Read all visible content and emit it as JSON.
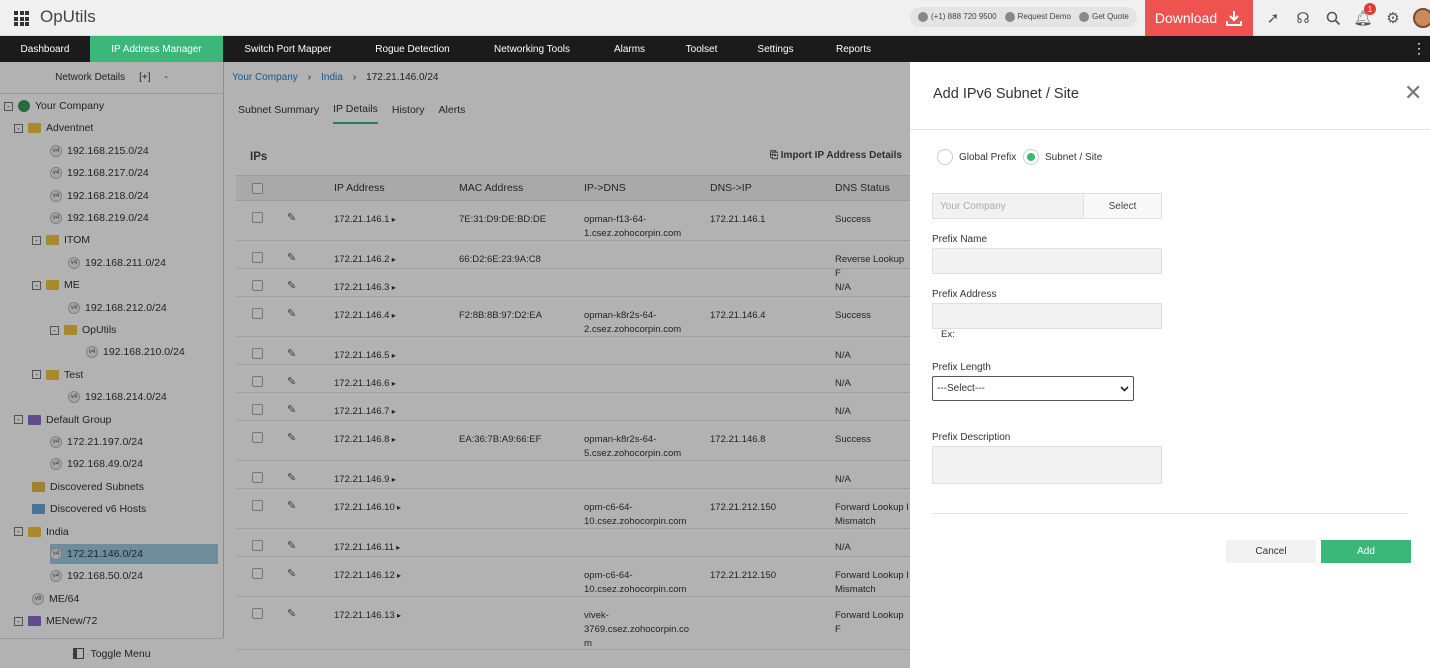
{
  "app": {
    "title": "OpUtils"
  },
  "contact": {
    "phone": "(+1) 888 720 9500",
    "demo": "Request Demo",
    "quote": "Get Quote"
  },
  "download_label": "Download",
  "notification_count": "1",
  "colors": {
    "brand_green": "#3ab779",
    "download_red": "#ef5350",
    "nav_bg": "#1b1b1b"
  },
  "nav": [
    "Dashboard",
    "IP Address Manager",
    "Switch Port Mapper",
    "Rogue Detection",
    "Networking Tools",
    "Alarms",
    "Toolset",
    "Settings",
    "Reports"
  ],
  "nav_active": "IP Address Manager",
  "sidebar": {
    "header": "Network Details",
    "expand": "[+]",
    "collapse": "-",
    "footer": "Toggle Menu",
    "tree": [
      {
        "label": "Your Company",
        "icon": "globe-icon",
        "toggle": "-"
      },
      {
        "label": "Adventnet",
        "icon": "folder-icon",
        "toggle": "-"
      },
      {
        "label": "192.168.215.0/24",
        "icon": "v4"
      },
      {
        "label": "192.168.217.0/24",
        "icon": "v4"
      },
      {
        "label": "192.168.218.0/24",
        "icon": "v4"
      },
      {
        "label": "192.168.219.0/24",
        "icon": "v4"
      },
      {
        "label": "ITOM",
        "icon": "folder-icon",
        "toggle": "-"
      },
      {
        "label": "192.168.211.0/24",
        "icon": "v4"
      },
      {
        "label": "ME",
        "icon": "folder-icon",
        "toggle": "-"
      },
      {
        "label": "192.168.212.0/24",
        "icon": "v4"
      },
      {
        "label": "OpUtils",
        "icon": "folder-icon",
        "toggle": "-"
      },
      {
        "label": "192.168.210.0/24",
        "icon": "v4"
      },
      {
        "label": "Test",
        "icon": "folder-icon",
        "toggle": "-"
      },
      {
        "label": "192.168.214.0/24",
        "icon": "v4"
      },
      {
        "label": "Default Group",
        "icon": "purple-folder-icon",
        "toggle": "-"
      },
      {
        "label": "172.21.197.0/24",
        "icon": "v4"
      },
      {
        "label": "192.168.49.0/24",
        "icon": "v4"
      },
      {
        "label": "Discovered Subnets",
        "icon": "discovered-subnets-icon"
      },
      {
        "label": "Discovered v6 Hosts",
        "icon": "discovered-hosts-icon"
      },
      {
        "label": "India",
        "icon": "folder-icon",
        "toggle": "-"
      },
      {
        "label": "172.21.146.0/24",
        "icon": "v4",
        "selected": true
      },
      {
        "label": "192.168.50.0/24",
        "icon": "v4"
      },
      {
        "label": "ME/64",
        "icon": "v6"
      },
      {
        "label": "MENew/72",
        "icon": "purple-folder-icon",
        "toggle": "-"
      }
    ]
  },
  "breadcrumb": [
    "Your Company",
    "India",
    "172.21.146.0/24"
  ],
  "tabs": [
    "Subnet Summary",
    "IP Details",
    "History",
    "Alerts"
  ],
  "active_tab": "IP Details",
  "ips_label": "IPs",
  "import_label": "Import IP Address Details",
  "table": {
    "columns": [
      "IP Address",
      "MAC Address",
      "IP->DNS",
      "DNS->IP",
      "DNS Status"
    ],
    "rows": [
      {
        "ip": "172.21.146.1",
        "mac": "7E:31:D9:DE:BD:DE",
        "ipdns": [
          "opman-f13-64-",
          "1.csez.zohocorpin.com"
        ],
        "dnsip": "172.21.146.1",
        "status": [
          "Success"
        ]
      },
      {
        "ip": "172.21.146.2",
        "mac": "66:D2:6E:23:9A:C8",
        "ipdns": [],
        "dnsip": "",
        "status": [
          "Reverse Lookup F"
        ]
      },
      {
        "ip": "172.21.146.3",
        "mac": "",
        "ipdns": [],
        "dnsip": "",
        "status": [
          "N/A"
        ]
      },
      {
        "ip": "172.21.146.4",
        "mac": "F2:8B:8B:97:D2:EA",
        "ipdns": [
          "opman-k8r2s-64-",
          "2.csez.zohocorpin.com"
        ],
        "dnsip": "172.21.146.4",
        "status": [
          "Success"
        ]
      },
      {
        "ip": "172.21.146.5",
        "mac": "",
        "ipdns": [],
        "dnsip": "",
        "status": [
          "N/A"
        ]
      },
      {
        "ip": "172.21.146.6",
        "mac": "",
        "ipdns": [],
        "dnsip": "",
        "status": [
          "N/A"
        ]
      },
      {
        "ip": "172.21.146.7",
        "mac": "",
        "ipdns": [],
        "dnsip": "",
        "status": [
          "N/A"
        ]
      },
      {
        "ip": "172.21.146.8",
        "mac": "EA:36:7B:A9:66:EF",
        "ipdns": [
          "opman-k8r2s-64-",
          "5.csez.zohocorpin.com"
        ],
        "dnsip": "172.21.146.8",
        "status": [
          "Success"
        ]
      },
      {
        "ip": "172.21.146.9",
        "mac": "",
        "ipdns": [],
        "dnsip": "",
        "status": [
          "N/A"
        ]
      },
      {
        "ip": "172.21.146.10",
        "mac": "",
        "ipdns": [
          "opm-c6-64-",
          "10.csez.zohocorpin.com"
        ],
        "dnsip": "172.21.212.150",
        "status": [
          "Forward Lookup I",
          "Mismatch"
        ]
      },
      {
        "ip": "172.21.146.11",
        "mac": "",
        "ipdns": [],
        "dnsip": "",
        "status": [
          "N/A"
        ]
      },
      {
        "ip": "172.21.146.12",
        "mac": "",
        "ipdns": [
          "opm-c6-64-",
          "10.csez.zohocorpin.com"
        ],
        "dnsip": "172.21.212.150",
        "status": [
          "Forward Lookup I",
          "Mismatch"
        ]
      },
      {
        "ip": "172.21.146.13",
        "mac": "",
        "ipdns": [
          "vivek-",
          "3769.csez.zohocorpin.co",
          "m"
        ],
        "dnsip": "",
        "status": [
          "Forward Lookup F"
        ]
      }
    ]
  },
  "panel": {
    "title": "Add IPv6 Subnet / Site",
    "radio_global": "Global Prefix",
    "radio_subnet": "Subnet / Site",
    "radio_selected": "Subnet / Site",
    "company_placeholder": "Your Company",
    "select_label": "Select",
    "prefix_name": "Prefix Name",
    "prefix_address": "Prefix Address",
    "ex_label": "Ex:",
    "prefix_length": "Prefix Length",
    "prefix_length_value": "---Select---",
    "prefix_description": "Prefix Description",
    "cancel": "Cancel",
    "add": "Add"
  }
}
